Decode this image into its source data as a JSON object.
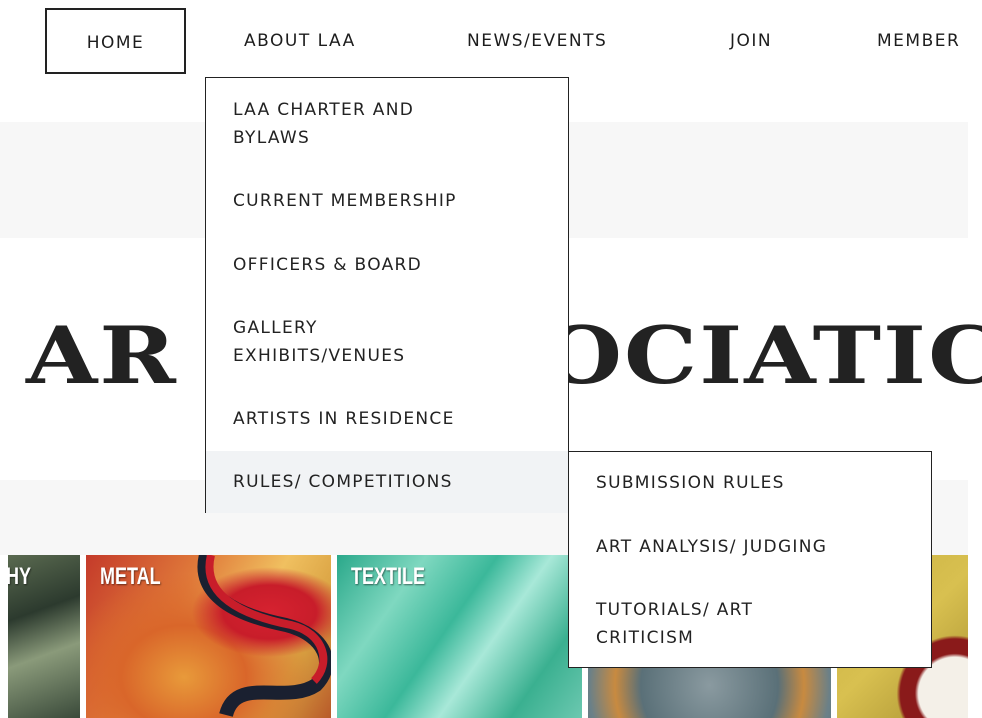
{
  "nav": {
    "items": [
      {
        "label": "HOME"
      },
      {
        "label": "ABOUT LAA"
      },
      {
        "label": "NEWS/EVENTS"
      },
      {
        "label": "JOIN"
      },
      {
        "label": "MEMBER"
      }
    ]
  },
  "hero": {
    "title_left": "AR",
    "title_right": "OCIATIC"
  },
  "about_menu": {
    "items": [
      {
        "label_line1": "LAA CHARTER AND",
        "label_line2": "BYLAWS"
      },
      {
        "label_line1": "CURRENT MEMBERSHIP"
      },
      {
        "label_line1": "OFFICERS & BOARD"
      },
      {
        "label_line1": "GALLERY",
        "label_line2": "EXHIBITS/VENUES"
      },
      {
        "label_line1": "ARTISTS IN RESIDENCE"
      },
      {
        "label_line1": "RULES/ COMPETITIONS"
      }
    ]
  },
  "rules_submenu": {
    "items": [
      {
        "label_line1": "SUBMISSION RULES"
      },
      {
        "label_line1": "ART ANALYSIS/ JUDGING"
      },
      {
        "label_line1": "TUTORIALS/ ART",
        "label_line2": "CRITICISM"
      }
    ]
  },
  "tiles": [
    {
      "label": "HY"
    },
    {
      "label": "METAL"
    },
    {
      "label": "TEXTILE"
    },
    {
      "label": ""
    },
    {
      "label": ""
    }
  ],
  "colors": {
    "border": "#222222",
    "active_bg": "#f1f3f5",
    "band": "#f7f7f7"
  }
}
